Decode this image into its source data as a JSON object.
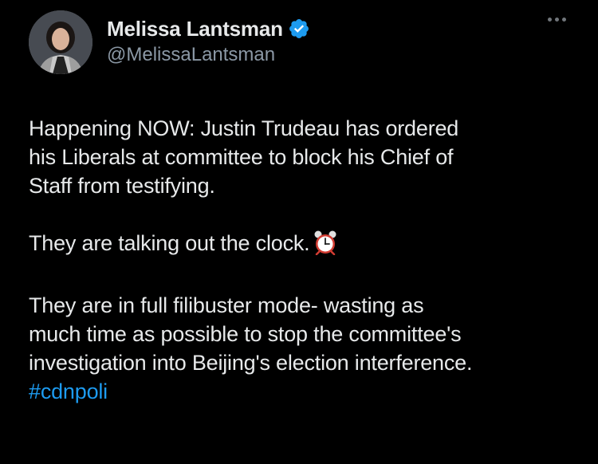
{
  "tweet": {
    "author": {
      "display_name": "Melissa Lantsman",
      "handle": "@MelissaLantsman",
      "verified_icon": "verified-badge-icon",
      "avatar_icon": "profile-avatar"
    },
    "more_icon": "more-options-icon",
    "paragraphs": [
      [
        "Happening NOW: Justin Trudeau has ordered",
        "his Liberals at committee to block his Chief of",
        "Staff from testifying."
      ],
      [
        "They are talking out the clock."
      ],
      [
        "They are in full filibuster mode-  wasting as",
        "much time as possible to stop the committee's",
        "investigation into Beijing's election interference."
      ]
    ],
    "p1_line1": "Happening NOW: Justin Trudeau has ordered",
    "p1_line2": "his Liberals at committee to block his Chief of",
    "p1_line3": "Staff from testifying.",
    "p2_text": "They are talking out the clock.",
    "p2_emoji": "alarm-clock-icon",
    "p3_line1": "They are in full filibuster mode-  wasting as",
    "p3_line2": "much time as possible to stop the committee's",
    "p3_line3": "investigation into Beijing's election interference.",
    "hashtag": "#cdnpoli"
  },
  "colors": {
    "background": "#000000",
    "text": "#e7e9ea",
    "secondary_text": "#8b98a5",
    "link": "#1d9bf0",
    "verified": "#1d9bf0"
  }
}
